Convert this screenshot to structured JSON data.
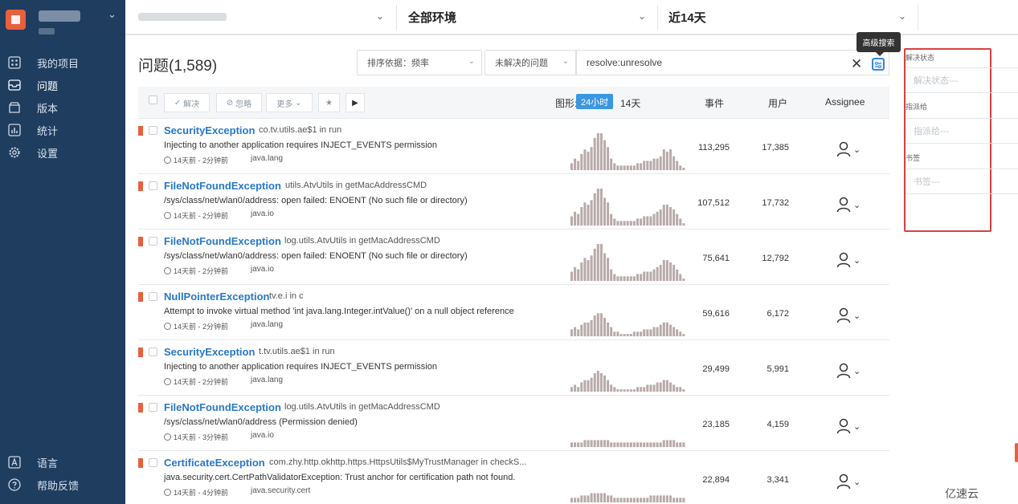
{
  "sidebar": {
    "items": [
      {
        "label": "我的项目",
        "icon": "dashboard-icon"
      },
      {
        "label": "问题",
        "icon": "inbox-icon",
        "active": true
      },
      {
        "label": "版本",
        "icon": "box-icon"
      },
      {
        "label": "统计",
        "icon": "bar-chart-icon"
      },
      {
        "label": "设置",
        "icon": "gear-icon"
      }
    ],
    "bottom": [
      {
        "label": "语言",
        "icon": "language-icon"
      },
      {
        "label": "帮助反馈",
        "icon": "help-icon"
      }
    ]
  },
  "topbar": {
    "environment": "全部环境",
    "period": "近14天"
  },
  "page": {
    "title": "问题(1,589)",
    "sort_label": "排序依据：频率",
    "status_filter": "未解决的问题",
    "search_query": "resolve:unresolve",
    "tooltip": "高级搜索"
  },
  "table": {
    "actions": {
      "resolve": "解决",
      "ignore": "忽略",
      "more": "更多"
    },
    "graph_label": "图形:",
    "graph_24h": "24小时",
    "graph_14d": "14天",
    "col_events": "事件",
    "col_users": "用户",
    "col_assignee": "Assignee",
    "rows": [
      {
        "title": "SecurityException",
        "culprit": "co.tv.utils.ae$1 in run",
        "message": "Injecting to another application requires INJECT_EVENTS permission",
        "time": "14天前 - 2分钟前",
        "platform": "java.lang",
        "events": "113,295",
        "users": "17,385",
        "spark": [
          3,
          5,
          4,
          7,
          9,
          8,
          10,
          14,
          16,
          16,
          13,
          10,
          5,
          3,
          2,
          2,
          2,
          2,
          2,
          2,
          3,
          3,
          4,
          4,
          4,
          5,
          5,
          6,
          9,
          8,
          9,
          6,
          4,
          2,
          1
        ]
      },
      {
        "title": "FileNotFoundException",
        "culprit": "utils.AtvUtils in getMacAddressCMD",
        "message": "/sys/class/net/wlan0/address: open failed: ENOENT (No such file or directory)",
        "time": "14天前 - 2分钟前",
        "platform": "java.io",
        "events": "107,512",
        "users": "17,732",
        "spark": [
          4,
          6,
          5,
          8,
          10,
          9,
          11,
          14,
          16,
          16,
          12,
          10,
          5,
          3,
          2,
          2,
          2,
          2,
          2,
          2,
          3,
          3,
          4,
          4,
          4,
          5,
          6,
          7,
          9,
          9,
          8,
          7,
          5,
          3,
          1
        ]
      },
      {
        "title": "FileNotFoundException",
        "culprit": "log.utils.AtvUtils in getMacAddressCMD",
        "message": "/sys/class/net/wlan0/address: open failed: ENOENT (No such file or directory)",
        "time": "14天前 - 2分钟前",
        "platform": "java.io",
        "events": "75,641",
        "users": "12,792",
        "spark": [
          4,
          6,
          5,
          8,
          10,
          9,
          11,
          14,
          16,
          16,
          12,
          10,
          5,
          3,
          2,
          2,
          2,
          2,
          2,
          2,
          3,
          3,
          4,
          4,
          4,
          5,
          6,
          7,
          9,
          9,
          8,
          7,
          5,
          3,
          1
        ]
      },
      {
        "title": "NullPointerException",
        "culprit": "tv.e.i in c",
        "message": "Attempt to invoke virtual method 'int java.lang.Integer.intValue()' on a null object reference",
        "time": "14天前 - 2分钟前",
        "platform": "java.lang",
        "events": "59,616",
        "users": "6,172",
        "spark": [
          3,
          4,
          3,
          5,
          6,
          6,
          7,
          9,
          10,
          10,
          8,
          6,
          4,
          2,
          2,
          1,
          1,
          1,
          1,
          2,
          2,
          2,
          3,
          3,
          3,
          4,
          4,
          5,
          6,
          6,
          5,
          4,
          3,
          2,
          1
        ]
      },
      {
        "title": "SecurityException",
        "culprit": "t.tv.utils.ae$1 in run",
        "message": "Injecting to another application requires INJECT_EVENTS permission",
        "time": "14天前 - 2分钟前",
        "platform": "java.lang",
        "events": "29,499",
        "users": "5,991",
        "spark": [
          2,
          3,
          2,
          4,
          5,
          5,
          6,
          8,
          9,
          8,
          7,
          5,
          3,
          2,
          1,
          1,
          1,
          1,
          1,
          1,
          2,
          2,
          2,
          3,
          3,
          3,
          4,
          4,
          5,
          5,
          4,
          3,
          2,
          2,
          1
        ]
      },
      {
        "title": "FileNotFoundException",
        "culprit": "log.utils.AtvUtils in getMacAddressCMD",
        "message": "/sys/class/net/wlan0/address (Permission denied)",
        "time": "14天前 - 3分钟前",
        "platform": "java.io",
        "events": "23,185",
        "users": "4,159",
        "spark": [
          2,
          2,
          2,
          2,
          3,
          3,
          3,
          3,
          3,
          3,
          3,
          3,
          2,
          2,
          2,
          2,
          2,
          2,
          2,
          2,
          2,
          2,
          2,
          2,
          2,
          2,
          2,
          2,
          3,
          3,
          3,
          3,
          2,
          2,
          2
        ]
      },
      {
        "title": "CertificateException",
        "culprit": "com.zhy.http.okhttp.https.HttpsUtils$MyTrustManager in checkS...",
        "message": "java.security.cert.CertPathValidatorException: Trust anchor for certification path not found.",
        "time": "14天前 - 4分钟前",
        "platform": "java.security.cert",
        "events": "22,894",
        "users": "3,341",
        "spark": [
          2,
          2,
          2,
          3,
          3,
          3,
          4,
          4,
          4,
          4,
          4,
          3,
          3,
          2,
          2,
          2,
          2,
          2,
          2,
          2,
          2,
          2,
          2,
          2,
          3,
          3,
          3,
          3,
          3,
          3,
          3,
          2,
          2,
          2,
          2
        ]
      }
    ]
  },
  "advanced_panel": {
    "status_label": "解决状态",
    "status_placeholder": "解决状态---",
    "assign_label": "指派给",
    "assign_placeholder": "指派给---",
    "tag_label": "书签",
    "tag_placeholder": "书签---"
  },
  "watermark": "亿速云",
  "colors": {
    "sidebar": "#1f3d5f",
    "accent": "#2878c8",
    "level": "#e8603c",
    "spark": "#b9aaaa",
    "highlight": "#d94040"
  }
}
